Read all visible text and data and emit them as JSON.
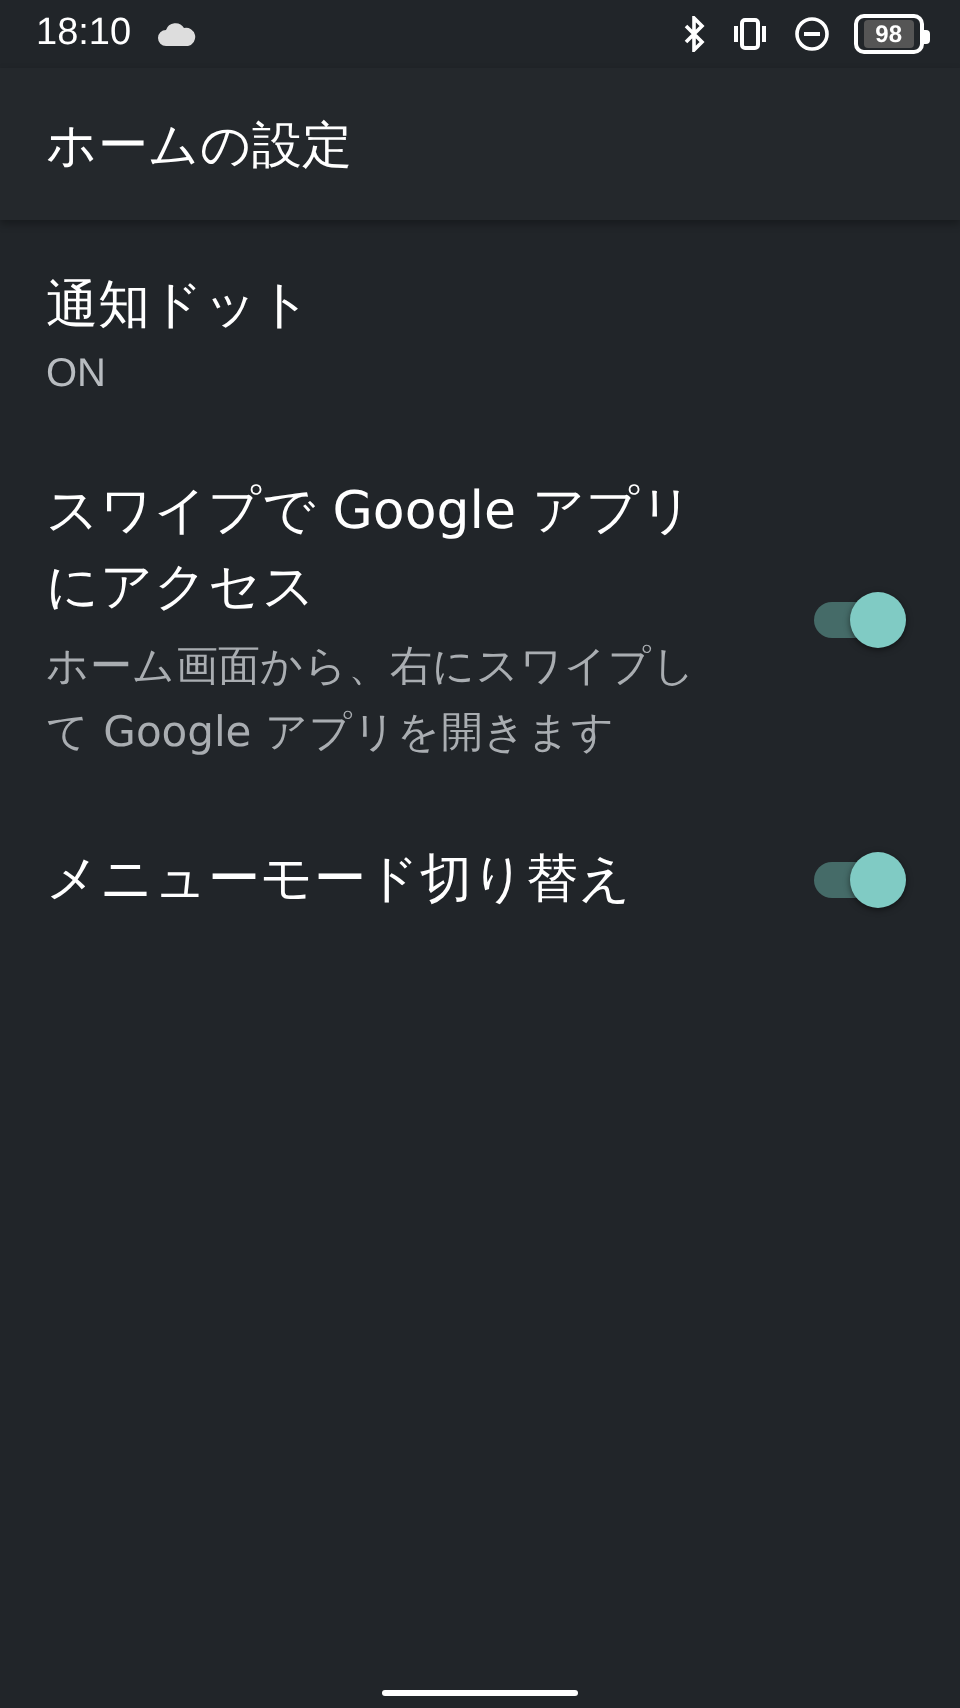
{
  "status_bar": {
    "time": "18:10",
    "battery": "98"
  },
  "header": {
    "title": "ホームの設定"
  },
  "settings": [
    {
      "kind": "value",
      "title": "通知ドット",
      "value": "ON"
    },
    {
      "kind": "switch",
      "title": "スワイプで Google アプリにアクセス",
      "summary": "ホーム画面から、右にスワイプして Google アプリを開きます",
      "on": true
    },
    {
      "kind": "switch",
      "title": "メニューモード切り替え",
      "on": true
    }
  ]
}
